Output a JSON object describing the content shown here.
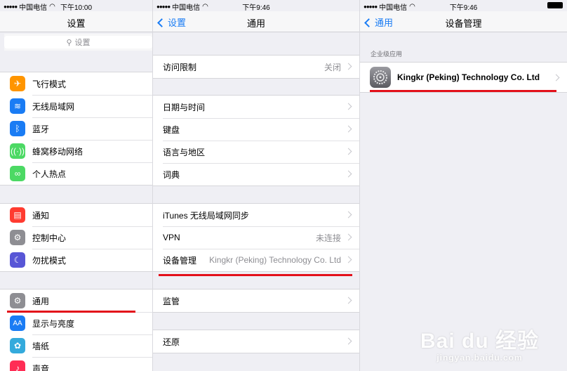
{
  "panel1": {
    "status": {
      "carrier": "中国电信",
      "time": "下午10:00"
    },
    "nav_title": "设置",
    "search_placeholder": "设置",
    "group1": [
      {
        "label": "飞行模式",
        "icon": "airplane-icon",
        "color": "#ff9500"
      },
      {
        "label": "无线局域网",
        "icon": "wifi-icon",
        "color": "#1a7cf4"
      },
      {
        "label": "蓝牙",
        "icon": "bluetooth-icon",
        "color": "#1a7cf4"
      },
      {
        "label": "蜂窝移动网络",
        "icon": "cellular-icon",
        "color": "#4cd964"
      },
      {
        "label": "个人热点",
        "icon": "hotspot-icon",
        "color": "#4cd964"
      }
    ],
    "group2": [
      {
        "label": "通知",
        "icon": "notifications-icon",
        "color": "#ff3b30"
      },
      {
        "label": "控制中心",
        "icon": "control-center-icon",
        "color": "#8e8e93"
      },
      {
        "label": "勿扰模式",
        "icon": "moon-icon",
        "color": "#5856d6"
      }
    ],
    "group3": [
      {
        "label": "通用",
        "icon": "gear-icon",
        "color": "#8e8e93"
      },
      {
        "label": "显示与亮度",
        "icon": "display-icon",
        "color": "#1a7cf4"
      },
      {
        "label": "墙纸",
        "icon": "wallpaper-icon",
        "color": "#34aadc"
      },
      {
        "label": "声音",
        "icon": "sound-icon",
        "color": "#ff2d55"
      }
    ]
  },
  "panel2": {
    "status": {
      "carrier": "中国电信",
      "time": "下午9:46"
    },
    "back_label": "设置",
    "nav_title": "通用",
    "restrictions": {
      "label": "访问限制",
      "value": "关闭"
    },
    "group2": [
      {
        "label": "日期与时间"
      },
      {
        "label": "键盘"
      },
      {
        "label": "语言与地区"
      },
      {
        "label": "词典"
      }
    ],
    "itunes": {
      "label": "iTunes 无线局域网同步"
    },
    "vpn": {
      "label": "VPN",
      "value": "未连接"
    },
    "device_mgmt": {
      "label": "设备管理",
      "value": "Kingkr (Peking) Technology Co. Ltd"
    },
    "supervision": {
      "label": "监管"
    },
    "reset": {
      "label": "还原"
    }
  },
  "panel3": {
    "status": {
      "carrier": "中国电信",
      "time": "下午9:46"
    },
    "back_label": "通用",
    "nav_title": "设备管理",
    "section_header": "企业级应用",
    "app_label": "Kingkr (Peking) Technology Co. Ltd"
  },
  "watermark": {
    "logo": "Bai du 经验",
    "url": "jingyan.baidu.com"
  },
  "colors": {
    "accent": "#1a7cf4",
    "highlight_red": "#e3101a"
  }
}
